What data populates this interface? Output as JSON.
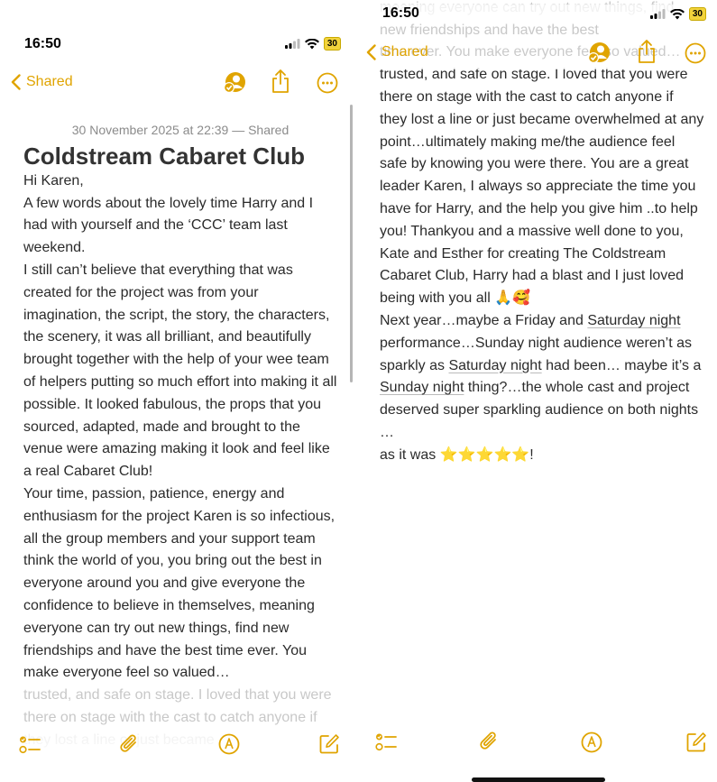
{
  "status": {
    "time": "16:50",
    "battery": "30"
  },
  "nav": {
    "back_label": "Shared"
  },
  "note": {
    "meta": "30 November 2025 at 22:39 — Shared",
    "title": "Coldstream Cabaret Club",
    "greeting": "Hi Karen,",
    "p1": "A few words about the lovely time Harry and I had with yourself and the ‘CCC’ team last weekend.",
    "p2": "I still can’t believe that everything that was created for the project was from your imagination, the script, the story, the characters, the scenery, it was all brilliant, and beautifully brought together with the help of your wee team of helpers putting so much effort into making it all possible. It looked fabulous, the props that you sourced, adapted, made and brought to the venue were amazing making it look and feel like a real Cabaret Club!",
    "p3": "Your time, passion, patience, energy and enthusiasm for the project Karen is so infectious, all the group members and your support team think the world of you, you bring out the best in everyone around you and give everyone the confidence to believe in themselves, meaning everyone can try out new things, find new friendships and have the best time ever. You make everyone feel so valued…",
    "left_faded": "trusted, and safe on stage. I loved that you were there on stage with the cast to catch anyone if they lost a line or just became",
    "right_faded": "everyone the confidence to believe in themselves, meaning everyone can try out new things, find new friendships and have the best",
    "right_p1": "time ever. You make everyone feel so valued… trusted, and safe on stage. I loved that you were there on stage with the cast to catch anyone if they lost a line or just became overwhelmed at any point…ultimately making me/the audience feel safe by knowing you were there. You are a great leader Karen, I always so appreciate the time you have for Harry, and the help you give him ..to help you! Thankyou and a massive well done to you, Kate and Esther for creating The Coldstream Cabaret Club, Harry had a blast and I just loved being with you all 🙏🥰",
    "right_p2_a": "Next year…maybe a Friday and ",
    "right_p2_link1": "Saturday night",
    "right_p2_b": " performance…Sunday night audience weren’t as sparkly as ",
    "right_p2_link2": "Saturday night",
    "right_p2_c": " had been… maybe it’s a ",
    "right_p2_link3": "Sunday night",
    "right_p2_d": " thing?…the whole cast and project deserved super sparkling audience on both nights …",
    "right_p3": "as it was ⭐⭐⭐⭐⭐!"
  },
  "icons": {
    "share_people": "person-share-icon",
    "share": "share-icon",
    "more": "more-icon",
    "checklist": "checklist-icon",
    "attach": "paperclip-icon",
    "markup": "pen-markup-icon",
    "compose": "compose-icon"
  },
  "colors": {
    "accent": "#e0a400",
    "text": "#2b2b2b",
    "meta": "#8b8b8b",
    "battery": "#f2d33b"
  }
}
